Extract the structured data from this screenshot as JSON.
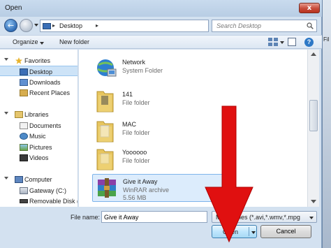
{
  "window": {
    "title": "Open",
    "close_glyph": "x"
  },
  "nav": {
    "back_glyph": "←",
    "breadcrumb_sep": "▸",
    "address": "Desktop",
    "refresh_glyph": "↻",
    "search_placeholder": "Search Desktop",
    "icons": [
      "back-arrow-icon",
      "forward-arrow-icon",
      "desktop-icon",
      "refresh-icon",
      "search-icon"
    ]
  },
  "toolbar": {
    "organize": "Organize",
    "new_folder": "New folder",
    "help_glyph": "?"
  },
  "navpane": {
    "favorites": "Favorites",
    "fav_items": [
      "Desktop",
      "Downloads",
      "Recent Places"
    ],
    "libraries": "Libraries",
    "lib_items": [
      "Documents",
      "Music",
      "Pictures",
      "Videos"
    ],
    "computer": "Computer",
    "comp_items": [
      "Gateway (C:)",
      "Removable Disk ("
    ]
  },
  "files": [
    {
      "name": "Network",
      "type": "System Folder",
      "icon": "network-icon"
    },
    {
      "name": "141",
      "type": "File folder",
      "icon": "folder-icon"
    },
    {
      "name": "MAC",
      "type": "File folder",
      "icon": "folder-icon"
    },
    {
      "name": "Yoooooo",
      "type": "File folder",
      "icon": "folder-icon"
    },
    {
      "name": "Give it Away",
      "type": "WinRAR archive",
      "size": "5.56 MB",
      "icon": "winrar-archive-icon"
    }
  ],
  "footer": {
    "filename_label": "File name:",
    "filename_value": "Give it Away",
    "filetype_value": "Movie Files (*.avi,*.wmv,*.mpg",
    "open_label": "Open",
    "cancel_label": "Cancel"
  },
  "side_text": "Fil",
  "colors": {
    "accent": "#cde3f7",
    "annotation_arrow": "#e01010"
  }
}
